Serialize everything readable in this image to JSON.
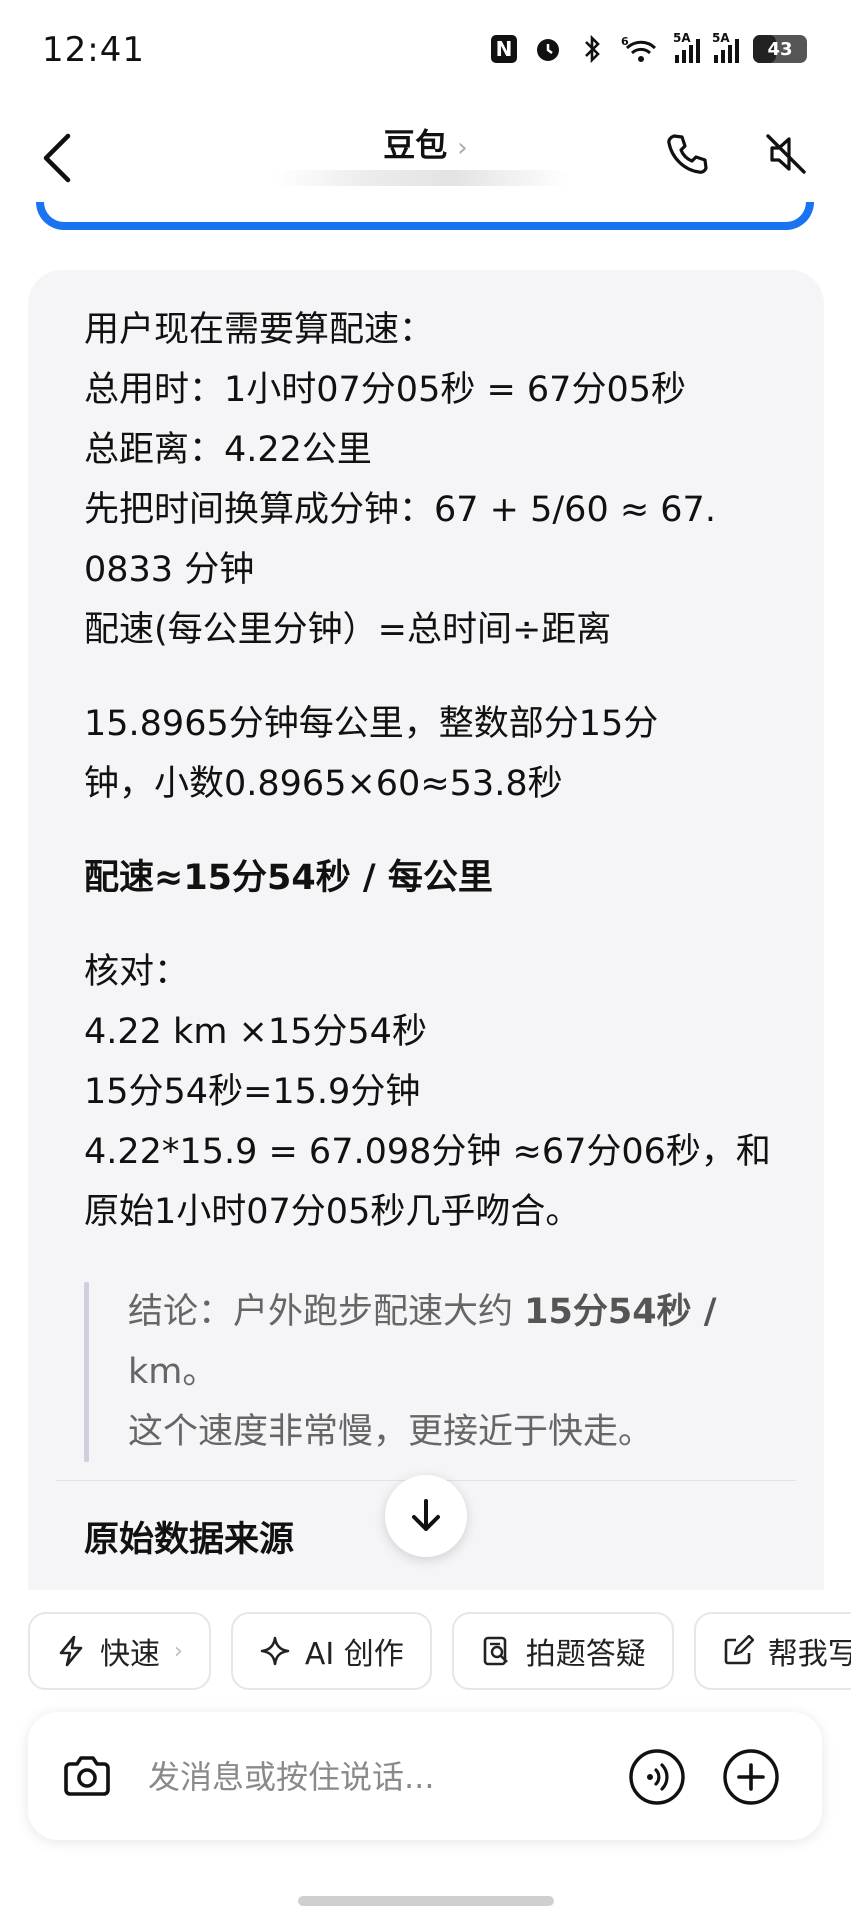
{
  "status_bar": {
    "time": "12:41",
    "battery": "43",
    "battery_level": 0.43,
    "signal_tag_1": "6",
    "signal_tag_2": "5A",
    "signal_tag_3": "5A"
  },
  "header": {
    "title": "豆包",
    "title_chevron": "›"
  },
  "message": {
    "lines_1": [
      "用户现在需要算配速：",
      "总用时：1小时07分05秒 = 67分05秒",
      "总距离：4.22公里",
      "先把时间换算成分钟：67 + 5/60 ≈ 67.",
      "0833 分钟",
      "配速(每公里分钟）=总时间÷距离"
    ],
    "lines_2": [
      "15.8965分钟每公里，整数部分15分",
      "钟，小数0.8965×60≈53.8秒"
    ],
    "pace_bold": "配速≈15分54秒 / 每公里",
    "lines_3": [
      "核对：",
      "4.22 km ×15分54秒",
      "15分54秒=15.9分钟",
      "4.22*15.9 = 67.098分钟 ≈67分06秒，和",
      "原始1小时07分05秒几乎吻合。"
    ],
    "quote": {
      "prefix": "结论：户外跑步配速大约 ",
      "bold": "15分54秒 /",
      "line2": "km。",
      "line3": "这个速度非常慢，更接近于快走。"
    },
    "section_title": "原始数据来源"
  },
  "chips": [
    {
      "label": "快速",
      "chevron": "›",
      "icon": "lightning-icon"
    },
    {
      "label": "AI 创作",
      "icon": "sparkle-icon"
    },
    {
      "label": "拍题答疑",
      "icon": "scan-question-icon"
    },
    {
      "label": "帮我写",
      "icon": "edit-icon"
    }
  ],
  "input": {
    "placeholder": "发消息或按住说话..."
  }
}
